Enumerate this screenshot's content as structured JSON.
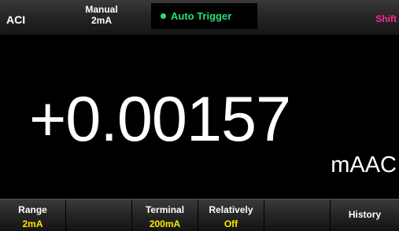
{
  "header": {
    "function": "ACI",
    "range_mode_line1": "Manual",
    "range_mode_line2": "2mA",
    "trigger_label": "Auto Trigger",
    "shift_label": "Shift"
  },
  "display": {
    "reading": "+0.00157",
    "unit": "mAAC"
  },
  "softkeys": [
    {
      "label": "Range",
      "value": "2mA"
    },
    {
      "label": "",
      "value": ""
    },
    {
      "label": "Terminal",
      "value": "200mA"
    },
    {
      "label": "Relatively",
      "value": "Off"
    },
    {
      "label": "",
      "value": ""
    },
    {
      "label": "History",
      "value": ""
    }
  ],
  "colors": {
    "trigger_accent": "#23e07a",
    "shift_accent": "#ff2a8f",
    "softkey_value": "#ffe600",
    "background": "#000000"
  }
}
